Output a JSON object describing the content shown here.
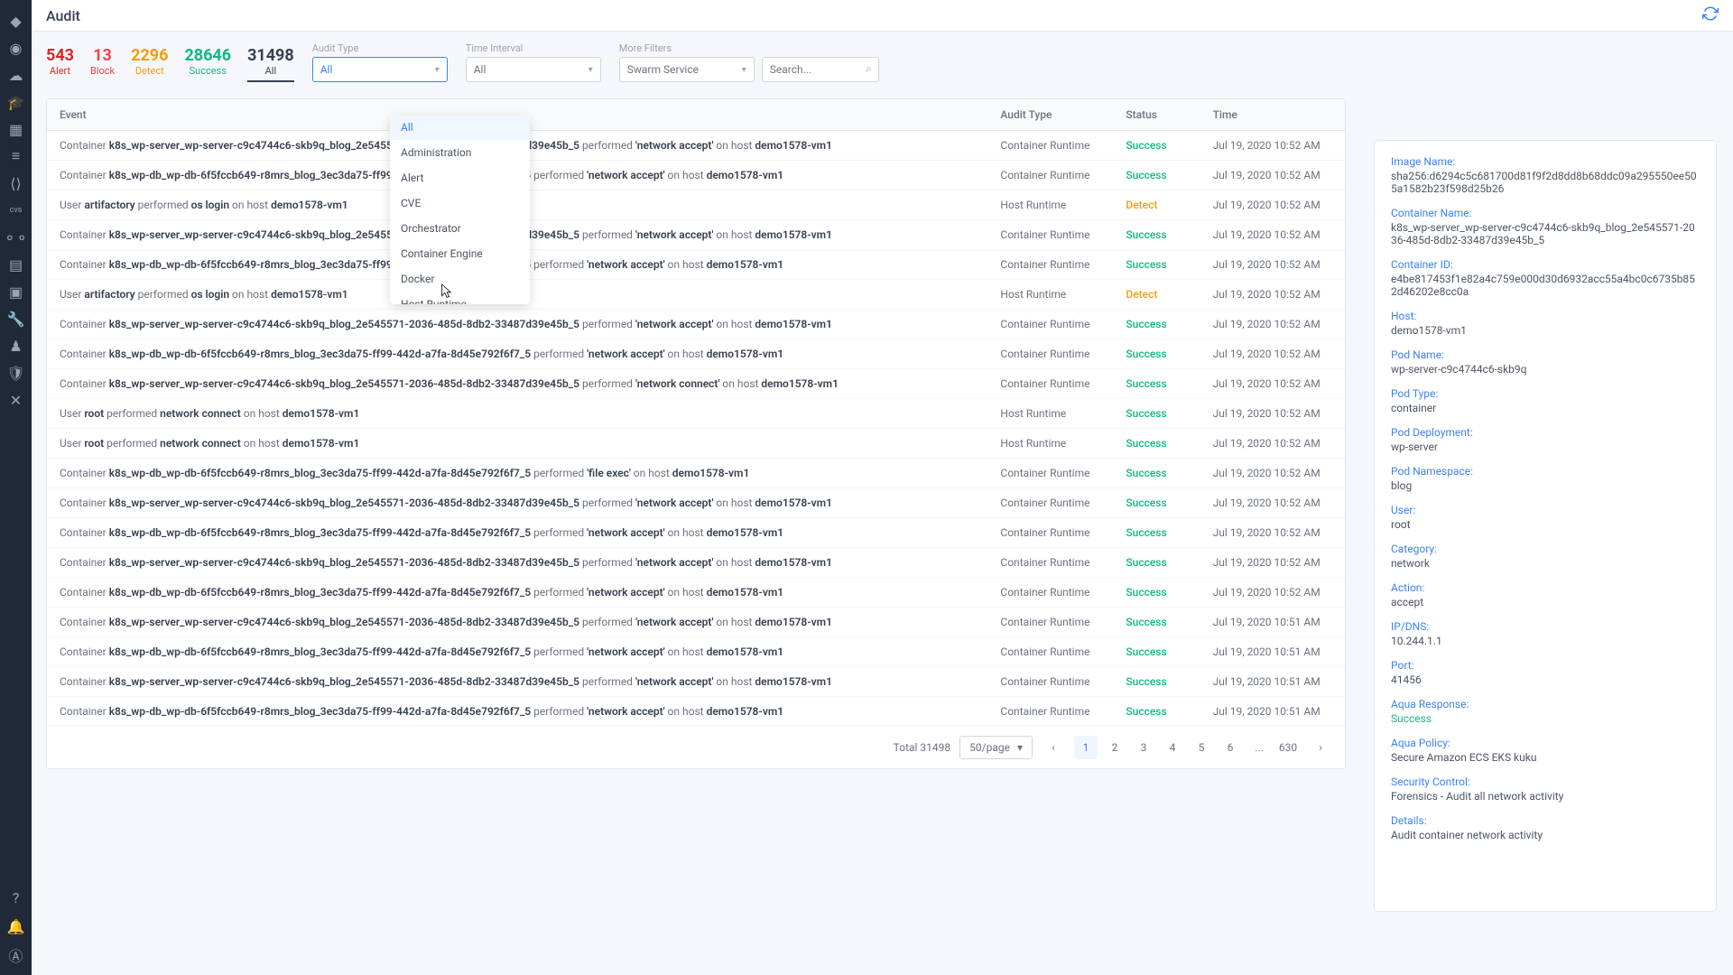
{
  "page_title": "Audit",
  "counters": [
    {
      "value": "543",
      "label": "Alert",
      "cls": "c-alert"
    },
    {
      "value": "13",
      "label": "Block",
      "cls": "c-block"
    },
    {
      "value": "2296",
      "label": "Detect",
      "cls": "c-detect"
    },
    {
      "value": "28646",
      "label": "Success",
      "cls": "c-success"
    },
    {
      "value": "31498",
      "label": "All",
      "cls": "c-all active"
    }
  ],
  "filters": {
    "audit_type_label": "Audit Type",
    "audit_type_value": "All",
    "time_interval_label": "Time Interval",
    "time_interval_value": "All",
    "more_filters_label": "More Filters",
    "more_filters_value": "Swarm Service",
    "search_placeholder": "Search..."
  },
  "dropdown_items": [
    "All",
    "Administration",
    "Alert",
    "CVE",
    "Orchestrator",
    "Container Engine",
    "Docker",
    "Host Runtime"
  ],
  "dropdown_selected": "All",
  "table": {
    "headers": [
      "Event",
      "Audit Type",
      "Status",
      "Time"
    ],
    "rows": [
      {
        "prefix": "Container",
        "subj": "k8s_wp-server_wp-server-c9c4744c6-skb9q_blog_2e545571-2036-485d-8db2-33487d39e45b_5",
        "verb": "performed",
        "act": "'network accept'",
        "on": "on host",
        "host": "demo1578-vm1",
        "type": "Container Runtime",
        "status": "Success",
        "time": "Jul 19, 2020 10:52 AM"
      },
      {
        "prefix": "Container",
        "subj": "k8s_wp-db_wp-db-6f5fccb649-r8mrs_blog_3ec3da75-ff99-442d-a7fa-8d45e792f6f7_5",
        "verb": "performed",
        "act": "'network accept'",
        "on": "on host",
        "host": "demo1578-vm1",
        "type": "Container Runtime",
        "status": "Success",
        "time": "Jul 19, 2020 10:52 AM"
      },
      {
        "prefix": "User",
        "subj": "artifactory",
        "verb": "performed",
        "act": "os login",
        "on": "on host",
        "host": "demo1578-vm1",
        "type": "Host Runtime",
        "status": "Detect",
        "time": "Jul 19, 2020 10:52 AM"
      },
      {
        "prefix": "Container",
        "subj": "k8s_wp-server_wp-server-c9c4744c6-skb9q_blog_2e545571-2036-485d-8db2-33487d39e45b_5",
        "verb": "performed",
        "act": "'network accept'",
        "on": "on host",
        "host": "demo1578-vm1",
        "type": "Container Runtime",
        "status": "Success",
        "time": "Jul 19, 2020 10:52 AM"
      },
      {
        "prefix": "Container",
        "subj": "k8s_wp-db_wp-db-6f5fccb649-r8mrs_blog_3ec3da75-ff99-442d-a7fa-8d45e792f6f7_5",
        "verb": "performed",
        "act": "'network accept'",
        "on": "on host",
        "host": "demo1578-vm1",
        "type": "Container Runtime",
        "status": "Success",
        "time": "Jul 19, 2020 10:52 AM"
      },
      {
        "prefix": "User",
        "subj": "artifactory",
        "verb": "performed",
        "act": "os login",
        "on": "on host",
        "host": "demo1578-vm1",
        "type": "Host Runtime",
        "status": "Detect",
        "time": "Jul 19, 2020 10:52 AM"
      },
      {
        "prefix": "Container",
        "subj": "k8s_wp-server_wp-server-c9c4744c6-skb9q_blog_2e545571-2036-485d-8db2-33487d39e45b_5",
        "verb": "performed",
        "act": "'network accept'",
        "on": "on host",
        "host": "demo1578-vm1",
        "type": "Container Runtime",
        "status": "Success",
        "time": "Jul 19, 2020 10:52 AM"
      },
      {
        "prefix": "Container",
        "subj": "k8s_wp-db_wp-db-6f5fccb649-r8mrs_blog_3ec3da75-ff99-442d-a7fa-8d45e792f6f7_5",
        "verb": "performed",
        "act": "'network accept'",
        "on": "on host",
        "host": "demo1578-vm1",
        "type": "Container Runtime",
        "status": "Success",
        "time": "Jul 19, 2020 10:52 AM"
      },
      {
        "prefix": "Container",
        "subj": "k8s_wp-server_wp-server-c9c4744c6-skb9q_blog_2e545571-2036-485d-8db2-33487d39e45b_5",
        "verb": "performed",
        "act": "'network connect'",
        "on": "on host",
        "host": "demo1578-vm1",
        "type": "Container Runtime",
        "status": "Success",
        "time": "Jul 19, 2020 10:52 AM"
      },
      {
        "prefix": "User",
        "subj": "root",
        "verb": "performed",
        "act": "network connect",
        "on": "on host",
        "host": "demo1578-vm1",
        "type": "Host Runtime",
        "status": "Success",
        "time": "Jul 19, 2020 10:52 AM"
      },
      {
        "prefix": "User",
        "subj": "root",
        "verb": "performed",
        "act": "network connect",
        "on": "on host",
        "host": "demo1578-vm1",
        "type": "Host Runtime",
        "status": "Success",
        "time": "Jul 19, 2020 10:52 AM"
      },
      {
        "prefix": "Container",
        "subj": "k8s_wp-db_wp-db-6f5fccb649-r8mrs_blog_3ec3da75-ff99-442d-a7fa-8d45e792f6f7_5",
        "verb": "performed",
        "act": "'file exec'",
        "on": "on host",
        "host": "demo1578-vm1",
        "type": "Container Runtime",
        "status": "Success",
        "time": "Jul 19, 2020 10:52 AM"
      },
      {
        "prefix": "Container",
        "subj": "k8s_wp-server_wp-server-c9c4744c6-skb9q_blog_2e545571-2036-485d-8db2-33487d39e45b_5",
        "verb": "performed",
        "act": "'network accept'",
        "on": "on host",
        "host": "demo1578-vm1",
        "type": "Container Runtime",
        "status": "Success",
        "time": "Jul 19, 2020 10:52 AM"
      },
      {
        "prefix": "Container",
        "subj": "k8s_wp-db_wp-db-6f5fccb649-r8mrs_blog_3ec3da75-ff99-442d-a7fa-8d45e792f6f7_5",
        "verb": "performed",
        "act": "'network accept'",
        "on": "on host",
        "host": "demo1578-vm1",
        "type": "Container Runtime",
        "status": "Success",
        "time": "Jul 19, 2020 10:52 AM"
      },
      {
        "prefix": "Container",
        "subj": "k8s_wp-server_wp-server-c9c4744c6-skb9q_blog_2e545571-2036-485d-8db2-33487d39e45b_5",
        "verb": "performed",
        "act": "'network accept'",
        "on": "on host",
        "host": "demo1578-vm1",
        "type": "Container Runtime",
        "status": "Success",
        "time": "Jul 19, 2020 10:52 AM"
      },
      {
        "prefix": "Container",
        "subj": "k8s_wp-db_wp-db-6f5fccb649-r8mrs_blog_3ec3da75-ff99-442d-a7fa-8d45e792f6f7_5",
        "verb": "performed",
        "act": "'network accept'",
        "on": "on host",
        "host": "demo1578-vm1",
        "type": "Container Runtime",
        "status": "Success",
        "time": "Jul 19, 2020 10:52 AM"
      },
      {
        "prefix": "Container",
        "subj": "k8s_wp-server_wp-server-c9c4744c6-skb9q_blog_2e545571-2036-485d-8db2-33487d39e45b_5",
        "verb": "performed",
        "act": "'network accept'",
        "on": "on host",
        "host": "demo1578-vm1",
        "type": "Container Runtime",
        "status": "Success",
        "time": "Jul 19, 2020 10:51 AM"
      },
      {
        "prefix": "Container",
        "subj": "k8s_wp-db_wp-db-6f5fccb649-r8mrs_blog_3ec3da75-ff99-442d-a7fa-8d45e792f6f7_5",
        "verb": "performed",
        "act": "'network accept'",
        "on": "on host",
        "host": "demo1578-vm1",
        "type": "Container Runtime",
        "status": "Success",
        "time": "Jul 19, 2020 10:51 AM"
      },
      {
        "prefix": "Container",
        "subj": "k8s_wp-server_wp-server-c9c4744c6-skb9q_blog_2e545571-2036-485d-8db2-33487d39e45b_5",
        "verb": "performed",
        "act": "'network accept'",
        "on": "on host",
        "host": "demo1578-vm1",
        "type": "Container Runtime",
        "status": "Success",
        "time": "Jul 19, 2020 10:51 AM"
      },
      {
        "prefix": "Container",
        "subj": "k8s_wp-db_wp-db-6f5fccb649-r8mrs_blog_3ec3da75-ff99-442d-a7fa-8d45e792f6f7_5",
        "verb": "performed",
        "act": "'network accept'",
        "on": "on host",
        "host": "demo1578-vm1",
        "type": "Container Runtime",
        "status": "Success",
        "time": "Jul 19, 2020 10:51 AM"
      }
    ]
  },
  "pagination": {
    "total_label": "Total 31498",
    "per_page": "50/page",
    "pages": [
      "1",
      "2",
      "3",
      "4",
      "5",
      "6",
      "...",
      "630"
    ],
    "active": "1"
  },
  "details": [
    {
      "label": "Image Name:",
      "value": "sha256:d6294c5c681700d81f9f2d8dd8b68ddc09a295550ee505a1582b23f598d25b26"
    },
    {
      "label": "Container Name:",
      "value": "k8s_wp-server_wp-server-c9c4744c6-skb9q_blog_2e545571-2036-485d-8db2-33487d39e45b_5"
    },
    {
      "label": "Container ID:",
      "value": "e4be817453f1e82a4c759e000d30d6932acc55a4bc0c6735b852d46202e8cc0a"
    },
    {
      "label": "Host:",
      "value": "demo1578-vm1"
    },
    {
      "label": "Pod Name:",
      "value": "wp-server-c9c4744c6-skb9q"
    },
    {
      "label": "Pod Type:",
      "value": "container"
    },
    {
      "label": "Pod Deployment:",
      "value": "wp-server"
    },
    {
      "label": "Pod Namespace:",
      "value": "blog"
    },
    {
      "label": "User:",
      "value": "root"
    },
    {
      "label": "Category:",
      "value": "network"
    },
    {
      "label": "Action:",
      "value": "accept"
    },
    {
      "label": "IP/DNS:",
      "value": "10.244.1.1"
    },
    {
      "label": "Port:",
      "value": "41456"
    },
    {
      "label": "Aqua Response:",
      "value": "Success",
      "success": true
    },
    {
      "label": "Aqua Policy:",
      "value": "Secure Amazon ECS EKS kuku"
    },
    {
      "label": "Security Control:",
      "value": "Forensics - Audit all network activity"
    },
    {
      "label": "Details:",
      "value": "Audit container network activity"
    }
  ]
}
